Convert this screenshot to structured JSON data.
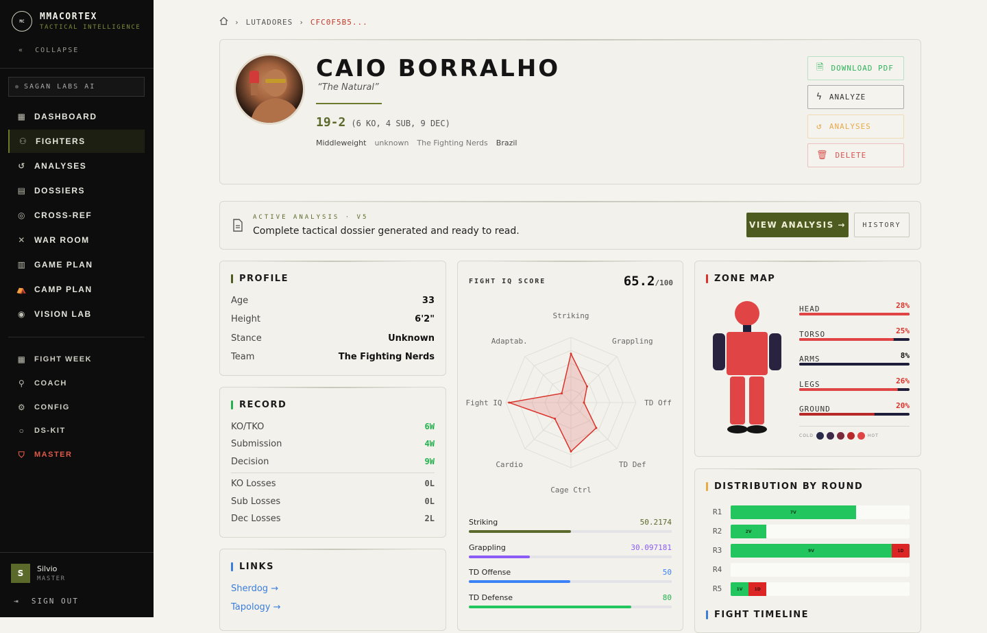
{
  "brand": {
    "logo": "MC",
    "name": "MMACORTEX",
    "subtitle": "TACTICAL INTELLIGENCE",
    "collapse": "COLLAPSE"
  },
  "tenant": "SAGAN LABS AI",
  "nav": [
    {
      "label": "DASHBOARD",
      "icon": "grid-icon"
    },
    {
      "label": "FIGHTERS",
      "icon": "users-icon",
      "active": true
    },
    {
      "label": "ANALYSES",
      "icon": "history-icon"
    },
    {
      "label": "DOSSIERS",
      "icon": "file-icon"
    },
    {
      "label": "CROSS-REF",
      "icon": "target-icon"
    },
    {
      "label": "WAR ROOM",
      "icon": "swords-icon"
    },
    {
      "label": "GAME PLAN",
      "icon": "clipboard-icon"
    },
    {
      "label": "CAMP PLAN",
      "icon": "tent-icon"
    },
    {
      "label": "VISION LAB",
      "icon": "eye-icon"
    }
  ],
  "nav2": [
    {
      "label": "FIGHT WEEK",
      "icon": "calendar-icon"
    },
    {
      "label": "COACH",
      "icon": "user-icon"
    },
    {
      "label": "CONFIG",
      "icon": "gear-icon"
    },
    {
      "label": "DS-KIT",
      "icon": "circle-icon"
    },
    {
      "label": "MASTER",
      "icon": "shield-icon"
    }
  ],
  "user": {
    "initial": "S",
    "name": "Silvio",
    "role": "MASTER"
  },
  "signout": "SIGN OUT",
  "breadcrumb": {
    "section": "LUTADORES",
    "current": "CFC0F5B5..."
  },
  "fighter": {
    "name": "CAIO BORRALHO",
    "nickname": "“The Natural”",
    "record": "19-2",
    "record_detail": "(6 KO, 4 SUB, 9 DEC)",
    "tags": [
      "Middleweight",
      "unknown",
      "The Fighting Nerds",
      "Brazil"
    ]
  },
  "actions": {
    "pdf": "DOWNLOAD PDF",
    "analyze": "ANALYZE",
    "analyses": "ANALYSES",
    "delete": "DELETE"
  },
  "active_analysis": {
    "label": "ACTIVE ANALYSIS · V5",
    "text": "Complete tactical dossier generated and ready to read.",
    "view": "VIEW ANALYSIS →",
    "history": "HISTORY"
  },
  "profile": {
    "title": "PROFILE",
    "rows": [
      {
        "k": "Age",
        "v": "33"
      },
      {
        "k": "Height",
        "v": "6'2\""
      },
      {
        "k": "Stance",
        "v": "Unknown"
      },
      {
        "k": "Team",
        "v": "The Fighting Nerds"
      }
    ]
  },
  "record_card": {
    "title": "RECORD",
    "wins": [
      {
        "k": "KO/TKO",
        "v": "6W"
      },
      {
        "k": "Submission",
        "v": "4W"
      },
      {
        "k": "Decision",
        "v": "9W"
      }
    ],
    "losses": [
      {
        "k": "KO Losses",
        "v": "0L"
      },
      {
        "k": "Sub Losses",
        "v": "0L"
      },
      {
        "k": "Dec Losses",
        "v": "2L"
      }
    ]
  },
  "links": {
    "title": "LINKS",
    "items": [
      "Sherdog →",
      "Tapology →"
    ]
  },
  "fight_iq": {
    "label": "FIGHT IQ SCORE",
    "score": "65.2",
    "max": "/100",
    "radar_axes": [
      "Striking",
      "Grappling",
      "TD Off",
      "TD Def",
      "Cage Ctrl",
      "Cardio",
      "Fight IQ",
      "Adaptab."
    ],
    "radar_values": [
      75,
      35,
      20,
      55,
      75,
      35,
      95,
      20
    ],
    "metrics": [
      {
        "name": "Striking",
        "value": "50.2174",
        "pct": 50.2174,
        "color": "#5b6a2a",
        "text_color": "#5b6a2a"
      },
      {
        "name": "Grappling",
        "value": "30.097181",
        "pct": 30.097181,
        "color": "#8b5cf6",
        "text_color": "#8b5cf6"
      },
      {
        "name": "TD Offense",
        "value": "50",
        "pct": 50,
        "color": "#3b82f6",
        "text_color": "#3b82f6"
      },
      {
        "name": "TD Defense",
        "value": "80",
        "pct": 80,
        "color": "#22c55e",
        "text_color": "#22b14c"
      }
    ]
  },
  "zone_map": {
    "title": "ZONE MAP",
    "zones": [
      {
        "name": "HEAD",
        "pct": "28%",
        "value": 28,
        "color": "#e04444"
      },
      {
        "name": "TORSO",
        "pct": "25%",
        "value": 25,
        "color": "#e04444"
      },
      {
        "name": "ARMS",
        "pct": "8%",
        "value": 8,
        "color": "#1e1e3a"
      },
      {
        "name": "LEGS",
        "pct": "26%",
        "value": 26,
        "color": "#e04444"
      },
      {
        "name": "GROUND",
        "pct": "20%",
        "value": 20,
        "color": "#b82a2a"
      }
    ],
    "legend": {
      "cold": "COLD",
      "hot": "HOT",
      "colors": [
        "#2a2a4a",
        "#3d2a4a",
        "#7a2a3a",
        "#b82a2a",
        "#e04444"
      ]
    }
  },
  "distribution": {
    "title": "DISTRIBUTION BY ROUND",
    "rounds": [
      {
        "label": "R1",
        "wins": 7,
        "losses": 0,
        "w_label": "7V",
        "l_label": ""
      },
      {
        "label": "R2",
        "wins": 2,
        "losses": 0,
        "w_label": "2V",
        "l_label": ""
      },
      {
        "label": "R3",
        "wins": 9,
        "losses": 1,
        "w_label": "9V",
        "l_label": "1D"
      },
      {
        "label": "R4",
        "wins": 0,
        "losses": 0,
        "w_label": "",
        "l_label": ""
      },
      {
        "label": "R5",
        "wins": 1,
        "losses": 1,
        "w_label": "1V",
        "l_label": "1D"
      }
    ],
    "scale_max": 10
  },
  "timeline_title": "FIGHT TIMELINE"
}
